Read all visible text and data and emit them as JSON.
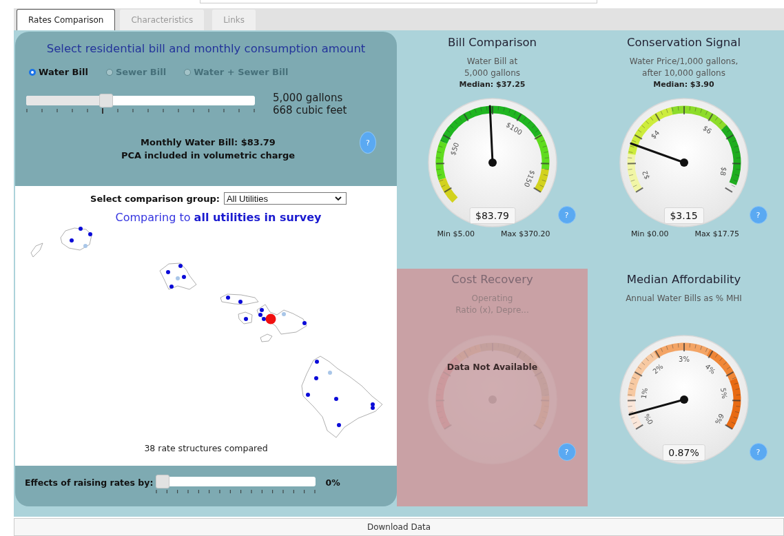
{
  "tabs": [
    {
      "label": "Rates Comparison",
      "selected": true
    },
    {
      "label": "Characteristics",
      "selected": false
    },
    {
      "label": "Links",
      "selected": false
    }
  ],
  "bill_panel": {
    "title": "Select residential bill and monthly consumption amount",
    "bill_types": [
      {
        "label": "Water Bill",
        "selected": true,
        "disabled": false
      },
      {
        "label": "Sewer Bill",
        "selected": false,
        "disabled": true
      },
      {
        "label": "Water + Sewer Bill",
        "selected": false,
        "disabled": true
      }
    ],
    "consumption": {
      "level": 0.34,
      "readings": [
        "5,000 gallons",
        "668 cubic feet"
      ]
    },
    "summary": [
      "Monthly Water Bill: $83.79",
      "PCA included in volumetric charge"
    ],
    "help": "?"
  },
  "comparison": {
    "group_label": "Select comparison group:",
    "group_value": "All Utilities",
    "caption": "Comparing to **all utilities in survey**",
    "count": "38 rate structures compared"
  },
  "rate_increase": {
    "label": "Effects of raising rates by:",
    "level": 0,
    "reading": "0%"
  },
  "gauges": [
    {
      "title": "Bill Comparison",
      "subtitle": [
        "Water Bill at",
        "5,000 gallons"
      ],
      "median": "Median: $37.25",
      "value": "$83.79",
      "min": "Min $5.00",
      "max": "Max $370.20",
      "ticks": [
        "$50",
        "$100",
        "$150"
      ],
      "available": true,
      "help": "?"
    },
    {
      "title": "Conservation Signal",
      "subtitle": [
        "Water Price/1,000 gallons,",
        "after 10,000 gallons"
      ],
      "median": "Median: $3.90",
      "value": "$3.15",
      "min": "Min $0.00",
      "max": "Max $17.75",
      "ticks": [
        "$2",
        "$4",
        "$6",
        "$8"
      ],
      "available": true,
      "help": "?"
    },
    {
      "title": "Cost Recovery",
      "subtitle": [
        "Operating",
        "Ratio (x), Depre..."
      ],
      "available": false,
      "notice": "Data Not Available",
      "help": "?"
    },
    {
      "title": "Median Affordability",
      "subtitle": [
        "Annual Water Bills as % MHI"
      ],
      "value": "0.87%",
      "ticks": [
        "0%",
        "1%",
        "2%",
        "3%",
        "4%",
        "5%",
        "6%"
      ],
      "available": true,
      "help": "?"
    }
  ],
  "download": "Download Data"
}
